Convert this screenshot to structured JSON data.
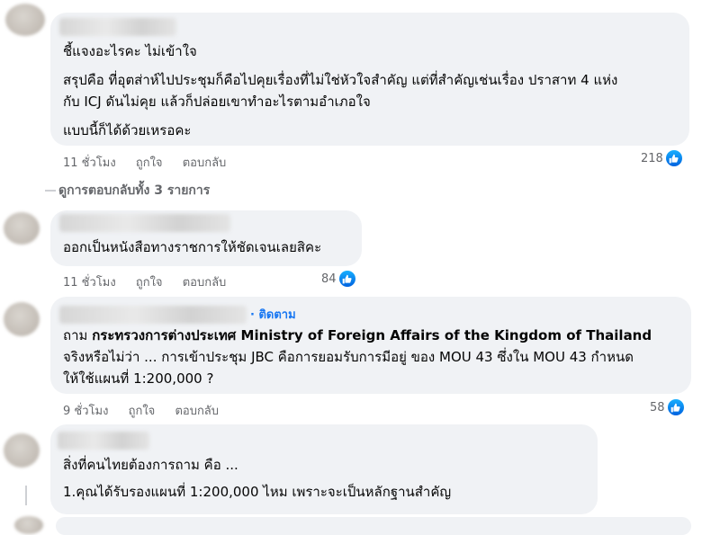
{
  "comments": [
    {
      "lines": [
        "ชี้แจงอะไรคะ ไม่เข้าใจ",
        "สรุปคือ ที่อุตส่าห์ไปประชุมก็คือไปคุยเรื่องที่ไม่ใช่หัวใจสำคัญ แต่ที่สำคัญเช่นเรื่อง ปราสาท 4 แห่ง",
        "กับ ICJ ดันไม่คุย แล้วก็ปล่อยเขาทำอะไรตามอำเภอใจ",
        "แบบนี้ก็ได้ด้วยเหรอคะ"
      ],
      "time": "11 ชั่วโมง",
      "like": "ถูกใจ",
      "reply": "ตอบกลับ",
      "reactions": "218"
    },
    {
      "lines": [
        "ออกเป็นหนังสือทางราชการให้ชัดเจนเลยสิคะ"
      ],
      "time": "11 ชั่วโมง",
      "like": "ถูกใจ",
      "reply": "ตอบกลับ",
      "reactions": "84"
    },
    {
      "follow": "· ติดตาม",
      "line1_prefix": "ถาม",
      "line1_bold": "กระทรวงการต่างประเทศ Ministry of Foreign Affairs of the Kingdom of Thailand",
      "lines": [
        "จริงหรือไม่ว่า ... การเข้าประชุม JBC คือการยอมรับการมีอยู่ ของ MOU 43 ซึ่งใน MOU 43 กำหนด",
        "ให้ใช้แผนที่ 1:200,000 ?"
      ],
      "time": "9 ชั่วโมง",
      "like": "ถูกใจ",
      "reply": "ตอบกลับ",
      "reactions": "58"
    },
    {
      "lines": [
        "สิ่งที่คนไทยต้องการถาม คือ ...",
        "1.คุณได้รับรองแผนที่ 1:200,000 ไหม เพราะจะเป็นหลักฐานสำคัญ"
      ]
    }
  ],
  "view_replies": "ดูการตอบกลับทั้ง 3 รายการ",
  "icons": {
    "like": "like-thumb-icon"
  },
  "colors": {
    "like_blue": "#1877f2",
    "bubble": "#f0f2f5",
    "meta": "#65676b"
  }
}
